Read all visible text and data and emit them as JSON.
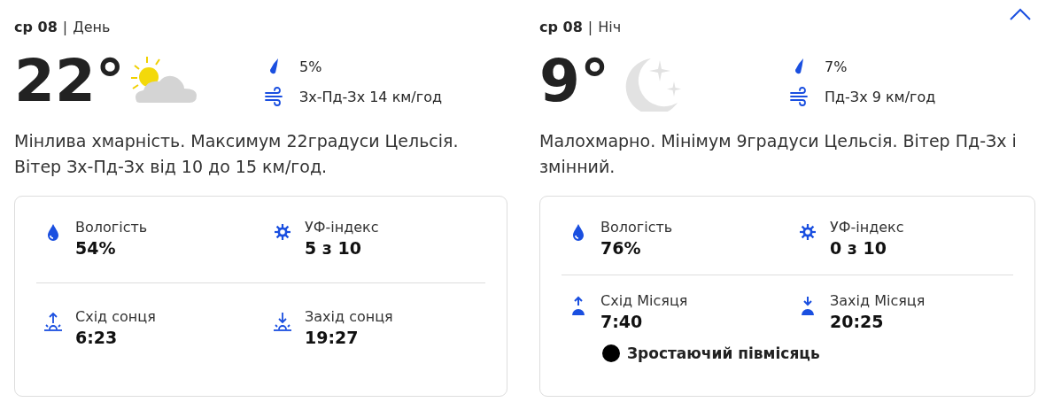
{
  "collapse_button": {
    "expanded": true
  },
  "panels": [
    {
      "date": "ср 08",
      "separator": "|",
      "period": "День",
      "kind": "day",
      "temperature": "22°",
      "precipitation": "5%",
      "wind": "Зх-Пд-Зх 14 км/год",
      "description": "Мінлива хмарність. Максимум 22градуси Цельсія. Вітер Зх-Пд-Зх від 10 до 15 км/год.",
      "details": [
        {
          "kind": "humidity",
          "label": "Вологість",
          "value": "54%"
        },
        {
          "kind": "uv",
          "label": "УФ-індекс",
          "value": "5 з 10"
        },
        {
          "kind": "sunrise",
          "label": "Схід сонця",
          "value": "6:23"
        },
        {
          "kind": "sunset",
          "label": "Захід сонця",
          "value": "19:27"
        }
      ]
    },
    {
      "date": "ср 08",
      "separator": "|",
      "period": "Ніч",
      "kind": "night",
      "temperature": "9°",
      "precipitation": "7%",
      "wind": "Пд-Зх 9 км/год",
      "description": "Малохмарно. Мінімум 9градуси Цельсія. Вітер Пд-Зх і змінний.",
      "details": [
        {
          "kind": "humidity",
          "label": "Вологість",
          "value": "76%"
        },
        {
          "kind": "uv",
          "label": "УФ-індекс",
          "value": "0 з 10"
        },
        {
          "kind": "moonrise",
          "label": "Схід Місяця",
          "value": "7:40"
        },
        {
          "kind": "moonset",
          "label": "Захід Місяця",
          "value": "20:25"
        }
      ],
      "moon_phase": "Зростаючий півмісяць"
    }
  ]
}
